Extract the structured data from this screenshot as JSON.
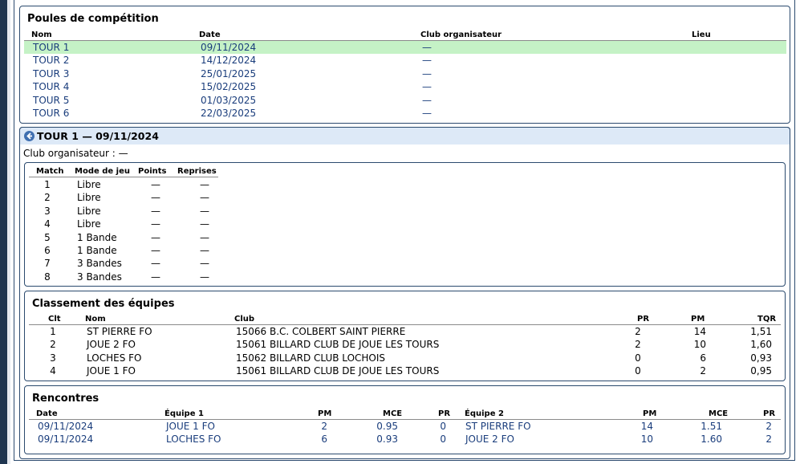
{
  "poules": {
    "title": "Poules de compétition",
    "headers": {
      "nom": "Nom",
      "date": "Date",
      "club": "Club organisateur",
      "lieu": "Lieu"
    },
    "rows": [
      {
        "nom": "TOUR 1",
        "date": "09/11/2024",
        "club": "—",
        "lieu": ""
      },
      {
        "nom": "TOUR 2",
        "date": "14/12/2024",
        "club": "—",
        "lieu": ""
      },
      {
        "nom": "TOUR 3",
        "date": "25/01/2025",
        "club": "—",
        "lieu": ""
      },
      {
        "nom": "TOUR 4",
        "date": "15/02/2025",
        "club": "—",
        "lieu": ""
      },
      {
        "nom": "TOUR 5",
        "date": "01/03/2025",
        "club": "—",
        "lieu": ""
      },
      {
        "nom": "TOUR 6",
        "date": "22/03/2025",
        "club": "—",
        "lieu": ""
      }
    ]
  },
  "tour": {
    "title": "TOUR 1 — 09/11/2024",
    "club_line": "Club organisateur : —",
    "matches": {
      "headers": {
        "match": "Match",
        "mode": "Mode de jeu",
        "points": "Points",
        "reprises": "Reprises"
      },
      "rows": [
        {
          "match": "1",
          "mode": "Libre",
          "points": "—",
          "reprises": "—"
        },
        {
          "match": "2",
          "mode": "Libre",
          "points": "—",
          "reprises": "—"
        },
        {
          "match": "3",
          "mode": "Libre",
          "points": "—",
          "reprises": "—"
        },
        {
          "match": "4",
          "mode": "Libre",
          "points": "—",
          "reprises": "—"
        },
        {
          "match": "5",
          "mode": "1 Bande",
          "points": "—",
          "reprises": "—"
        },
        {
          "match": "6",
          "mode": "1 Bande",
          "points": "—",
          "reprises": "—"
        },
        {
          "match": "7",
          "mode": "3 Bandes",
          "points": "—",
          "reprises": "—"
        },
        {
          "match": "8",
          "mode": "3 Bandes",
          "points": "—",
          "reprises": "—"
        }
      ]
    },
    "classement": {
      "title": "Classement des équipes",
      "headers": {
        "clt": "Clt",
        "nom": "Nom",
        "club": "Club",
        "pr": "PR",
        "pm": "PM",
        "tqr": "TQR"
      },
      "rows": [
        {
          "clt": "1",
          "nom": "ST PIERRE FO",
          "club": "15066 B.C. COLBERT SAINT PIERRE",
          "pr": "2",
          "pm": "14",
          "tqr": "1,51"
        },
        {
          "clt": "2",
          "nom": "JOUE 2 FO",
          "club": "15061 BILLARD CLUB DE JOUE LES TOURS",
          "pr": "2",
          "pm": "10",
          "tqr": "1,60"
        },
        {
          "clt": "3",
          "nom": "LOCHES FO",
          "club": "15062 BILLARD CLUB LOCHOIS",
          "pr": "0",
          "pm": "6",
          "tqr": "0,93"
        },
        {
          "clt": "4",
          "nom": "JOUE 1 FO",
          "club": "15061 BILLARD CLUB DE JOUE LES TOURS",
          "pr": "0",
          "pm": "2",
          "tqr": "0,95"
        }
      ]
    },
    "rencontres": {
      "title": "Rencontres",
      "headers": {
        "date": "Date",
        "eq1": "Équipe 1",
        "pm1": "PM",
        "mce1": "MCE",
        "pr1": "PR",
        "eq2": "Équipe 2",
        "pm2": "PM",
        "mce2": "MCE",
        "pr2": "PR"
      },
      "rows": [
        {
          "date": "09/11/2024",
          "eq1": "JOUE 1 FO",
          "pm1": "2",
          "mce1": "0.95",
          "pr1": "0",
          "eq2": "ST PIERRE FO",
          "pm2": "14",
          "mce2": "1.51",
          "pr2": "2"
        },
        {
          "date": "09/11/2024",
          "eq1": "LOCHES FO",
          "pm1": "6",
          "mce1": "0.93",
          "pr1": "0",
          "eq2": "JOUE 2 FO",
          "pm2": "10",
          "mce2": "1.60",
          "pr2": "2"
        }
      ]
    }
  }
}
